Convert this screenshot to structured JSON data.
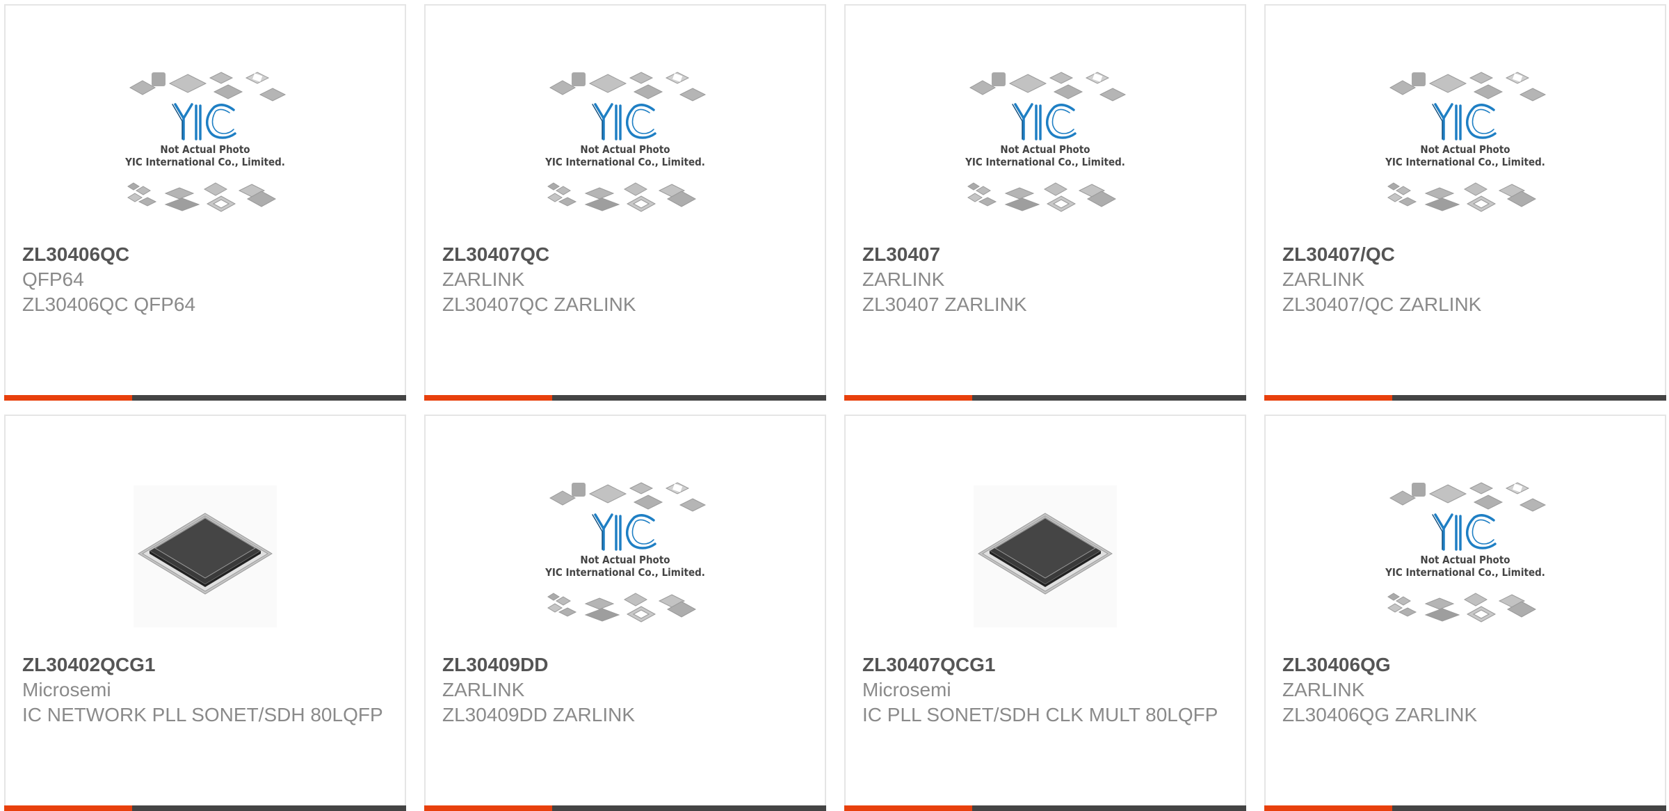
{
  "products": [
    {
      "part_number": "ZL30406QC",
      "line1": "QFP64",
      "line2": "ZL30406QC QFP64",
      "image": "placeholder",
      "placeholder_text_1": "Not Actual Photo",
      "placeholder_text_2": "YIC International Co., Limited.",
      "logo_text": "YIC"
    },
    {
      "part_number": "ZL30407QC",
      "line1": "ZARLINK",
      "line2": "ZL30407QC ZARLINK",
      "image": "placeholder",
      "placeholder_text_1": "Not Actual Photo",
      "placeholder_text_2": "YIC International Co., Limited.",
      "logo_text": "YIC"
    },
    {
      "part_number": "ZL30407",
      "line1": "ZARLINK",
      "line2": "ZL30407 ZARLINK",
      "image": "placeholder",
      "placeholder_text_1": "Not Actual Photo",
      "placeholder_text_2": "YIC International Co., Limited.",
      "logo_text": "YIC"
    },
    {
      "part_number": "ZL30407/QC",
      "line1": "ZARLINK",
      "line2": "ZL30407/QC ZARLINK",
      "image": "placeholder",
      "placeholder_text_1": "Not Actual Photo",
      "placeholder_text_2": "YIC International Co., Limited.",
      "logo_text": "YIC"
    },
    {
      "part_number": "ZL30402QCG1",
      "line1": "Microsemi",
      "line2": "IC NETWORK PLL SONET/SDH 80LQFP",
      "image": "chip"
    },
    {
      "part_number": "ZL30409DD",
      "line1": "ZARLINK",
      "line2": "ZL30409DD ZARLINK",
      "image": "placeholder",
      "placeholder_text_1": "Not Actual Photo",
      "placeholder_text_2": "YIC International Co., Limited.",
      "logo_text": "YIC"
    },
    {
      "part_number": "ZL30407QCG1",
      "line1": "Microsemi",
      "line2": "IC PLL SONET/SDH CLK MULT 80LQFP",
      "image": "chip"
    },
    {
      "part_number": "ZL30406QG",
      "line1": "ZARLINK",
      "line2": "ZL30406QG ZARLINK",
      "image": "placeholder",
      "placeholder_text_1": "Not Actual Photo",
      "placeholder_text_2": "YIC International Co., Limited.",
      "logo_text": "YIC"
    }
  ],
  "colors": {
    "accent": "#e8400c",
    "bar": "#444444",
    "logo_blue": "#1f7fc4",
    "part_number": "#555555",
    "text": "#8a8a8a"
  }
}
